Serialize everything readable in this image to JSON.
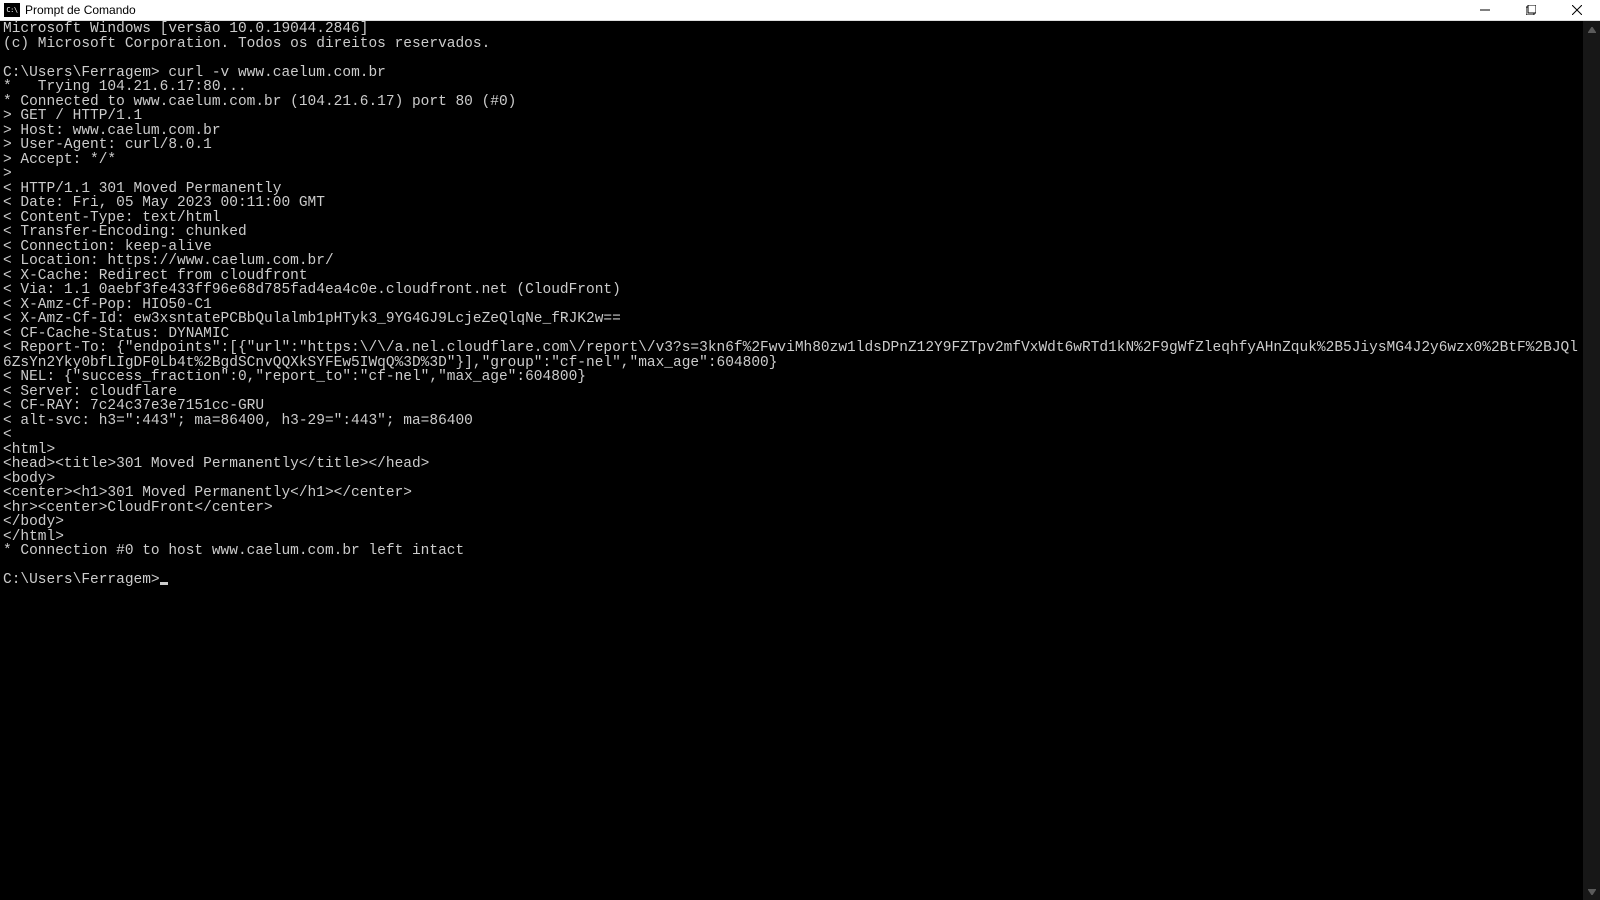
{
  "window": {
    "icon_label": "C:\\",
    "title": "Prompt de Comando"
  },
  "terminal": {
    "banner1": "Microsoft Windows [versão 10.0.19044.2846]",
    "banner2": "(c) Microsoft Corporation. Todos os direitos reservados.",
    "blank": "",
    "prompt1_path": "C:\\Users\\Ferragem>",
    "prompt1_cmd": " curl -v www.caelum.com.br",
    "lines": [
      "*   Trying 104.21.6.17:80...",
      "* Connected to www.caelum.com.br (104.21.6.17) port 80 (#0)",
      "> GET / HTTP/1.1",
      "> Host: www.caelum.com.br",
      "> User-Agent: curl/8.0.1",
      "> Accept: */*",
      ">",
      "< HTTP/1.1 301 Moved Permanently",
      "< Date: Fri, 05 May 2023 00:11:00 GMT",
      "< Content-Type: text/html",
      "< Transfer-Encoding: chunked",
      "< Connection: keep-alive",
      "< Location: https://www.caelum.com.br/",
      "< X-Cache: Redirect from cloudfront",
      "< Via: 1.1 0aebf3fe433ff96e68d785fad4ea4c0e.cloudfront.net (CloudFront)",
      "< X-Amz-Cf-Pop: HIO50-C1",
      "< X-Amz-Cf-Id: ew3xsntatePCBbQulalmb1pHTyk3_9YG4GJ9LcjeZeQlqNe_fRJK2w==",
      "< CF-Cache-Status: DYNAMIC",
      "< Report-To: {\"endpoints\":[{\"url\":\"https:\\/\\/a.nel.cloudflare.com\\/report\\/v3?s=3kn6f%2FwviMh80zw1ldsDPnZ12Y9FZTpv2mfVxWdt6wRTd1kN%2F9gWfZleqhfyAHnZquk%2B5JiysMG4J2y6wzx0%2BtF%2BJQl6ZsYn2Yky0bfLIgDF0Lb4t%2BgdSCnvQQXkSYFEw5IWqQ%3D%3D\"}],\"group\":\"cf-nel\",\"max_age\":604800}",
      "< NEL: {\"success_fraction\":0,\"report_to\":\"cf-nel\",\"max_age\":604800}",
      "< Server: cloudflare",
      "< CF-RAY: 7c24c37e3e7151cc-GRU",
      "< alt-svc: h3=\":443\"; ma=86400, h3-29=\":443\"; ma=86400",
      "<",
      "<html>",
      "<head><title>301 Moved Permanently</title></head>",
      "<body>",
      "<center><h1>301 Moved Permanently</h1></center>",
      "<hr><center>CloudFront</center>",
      "</body>",
      "</html>",
      "* Connection #0 to host www.caelum.com.br left intact"
    ],
    "prompt2_path": "C:\\Users\\Ferragem>"
  }
}
